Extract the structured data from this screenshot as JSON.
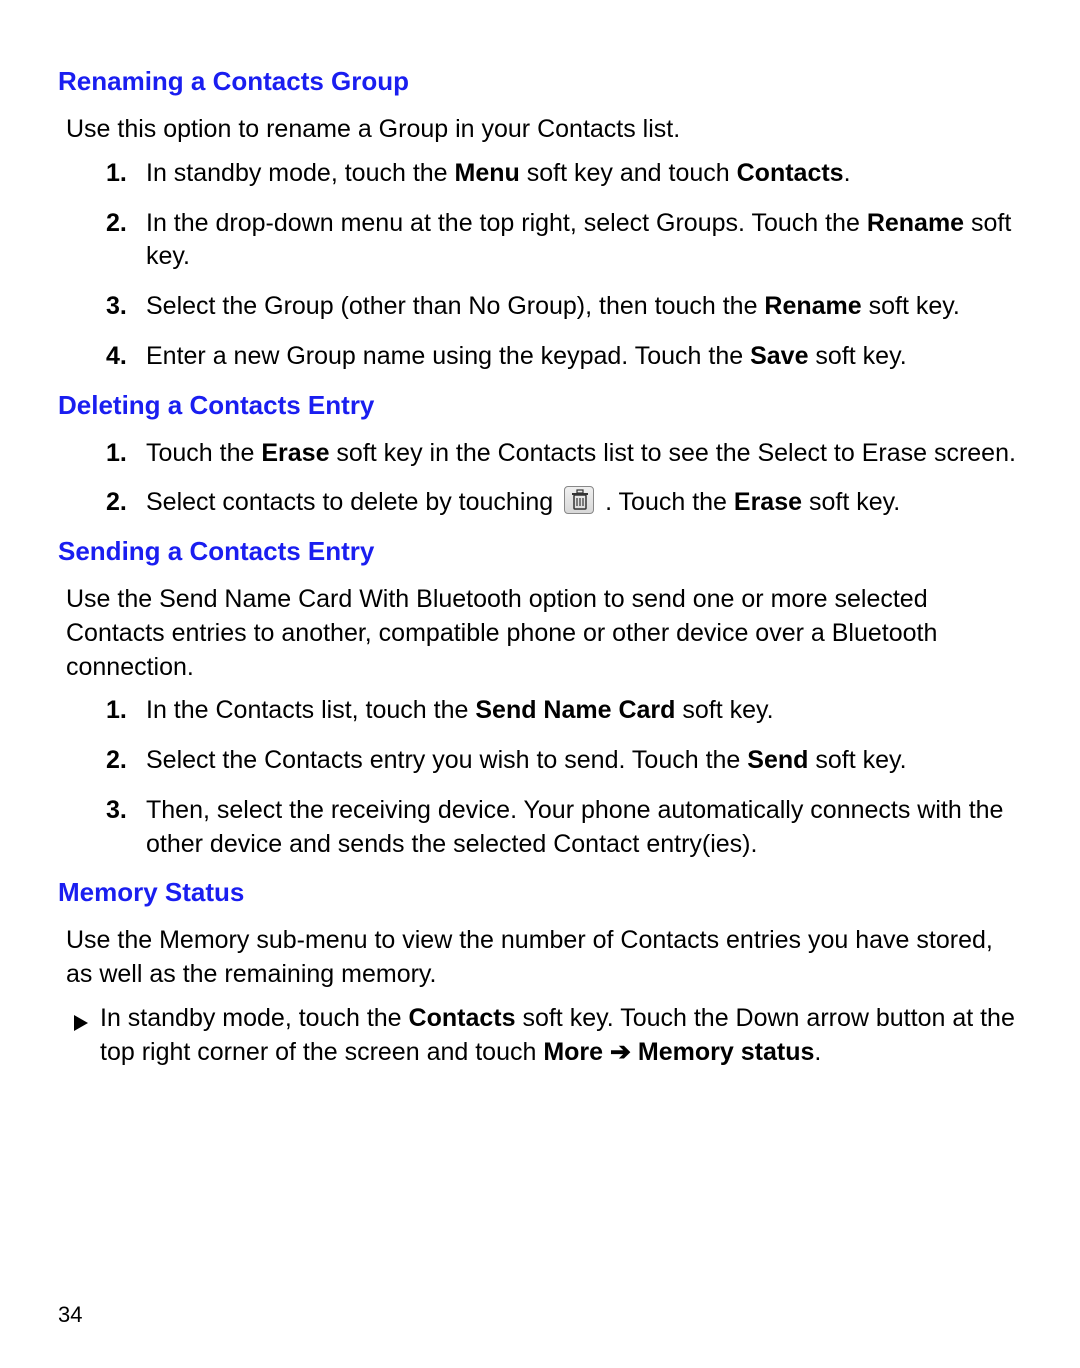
{
  "page_number": "34",
  "sections": {
    "rename": {
      "heading": "Renaming a Contacts Group",
      "intro": "Use this option to rename a Group in your Contacts list.",
      "step1_a": "In standby mode, touch the ",
      "step1_b": "Menu",
      "step1_c": " soft key and touch ",
      "step1_d": "Contacts",
      "step1_e": ".",
      "step2_a": "In the drop-down menu at the top right, select Groups. Touch the ",
      "step2_b": "Rename",
      "step2_c": " soft key.",
      "step3_a": "Select the Group (other than No Group), then touch the ",
      "step3_b": "Rename",
      "step3_c": " soft key.",
      "step4_a": "Enter a new Group name using the keypad. Touch the ",
      "step4_b": "Save",
      "step4_c": " soft key."
    },
    "delete": {
      "heading": "Deleting a Contacts Entry",
      "step1_a": "Touch the ",
      "step1_b": "Erase",
      "step1_c": " soft key in the Contacts list to see the Select to Erase screen.",
      "step2_a": "Select contacts to delete by touching ",
      "step2_b": " . Touch the ",
      "step2_c": "Erase",
      "step2_d": " soft key."
    },
    "send": {
      "heading": "Sending a Contacts Entry",
      "intro": "Use the Send Name Card With Bluetooth option to send one or more selected Contacts entries to another, compatible phone or other device over a Bluetooth connection.",
      "step1_a": "In the Contacts list, touch the ",
      "step1_b": "Send Name Card",
      "step1_c": " soft key.",
      "step2_a": "Select the Contacts entry you wish to send. Touch the ",
      "step2_b": "Send",
      "step2_c": " soft key.",
      "step3": "Then, select the receiving device. Your phone automatically connects with the other device and sends the selected Contact entry(ies)."
    },
    "memory": {
      "heading": "Memory Status",
      "intro": "Use the Memory sub-menu to view the number of Contacts entries you have stored, as well as the remaining memory.",
      "bullet_a": "In standby mode, touch the ",
      "bullet_b": "Contacts",
      "bullet_c": " soft key. Touch the Down arrow button at the top right corner of the screen and touch ",
      "bullet_d": "More",
      "bullet_e": " ",
      "bullet_arrow": "➔",
      "bullet_f": " ",
      "bullet_g": "Memory status",
      "bullet_h": "."
    }
  },
  "nums": {
    "n1": "1.",
    "n2": "2.",
    "n3": "3.",
    "n4": "4."
  }
}
